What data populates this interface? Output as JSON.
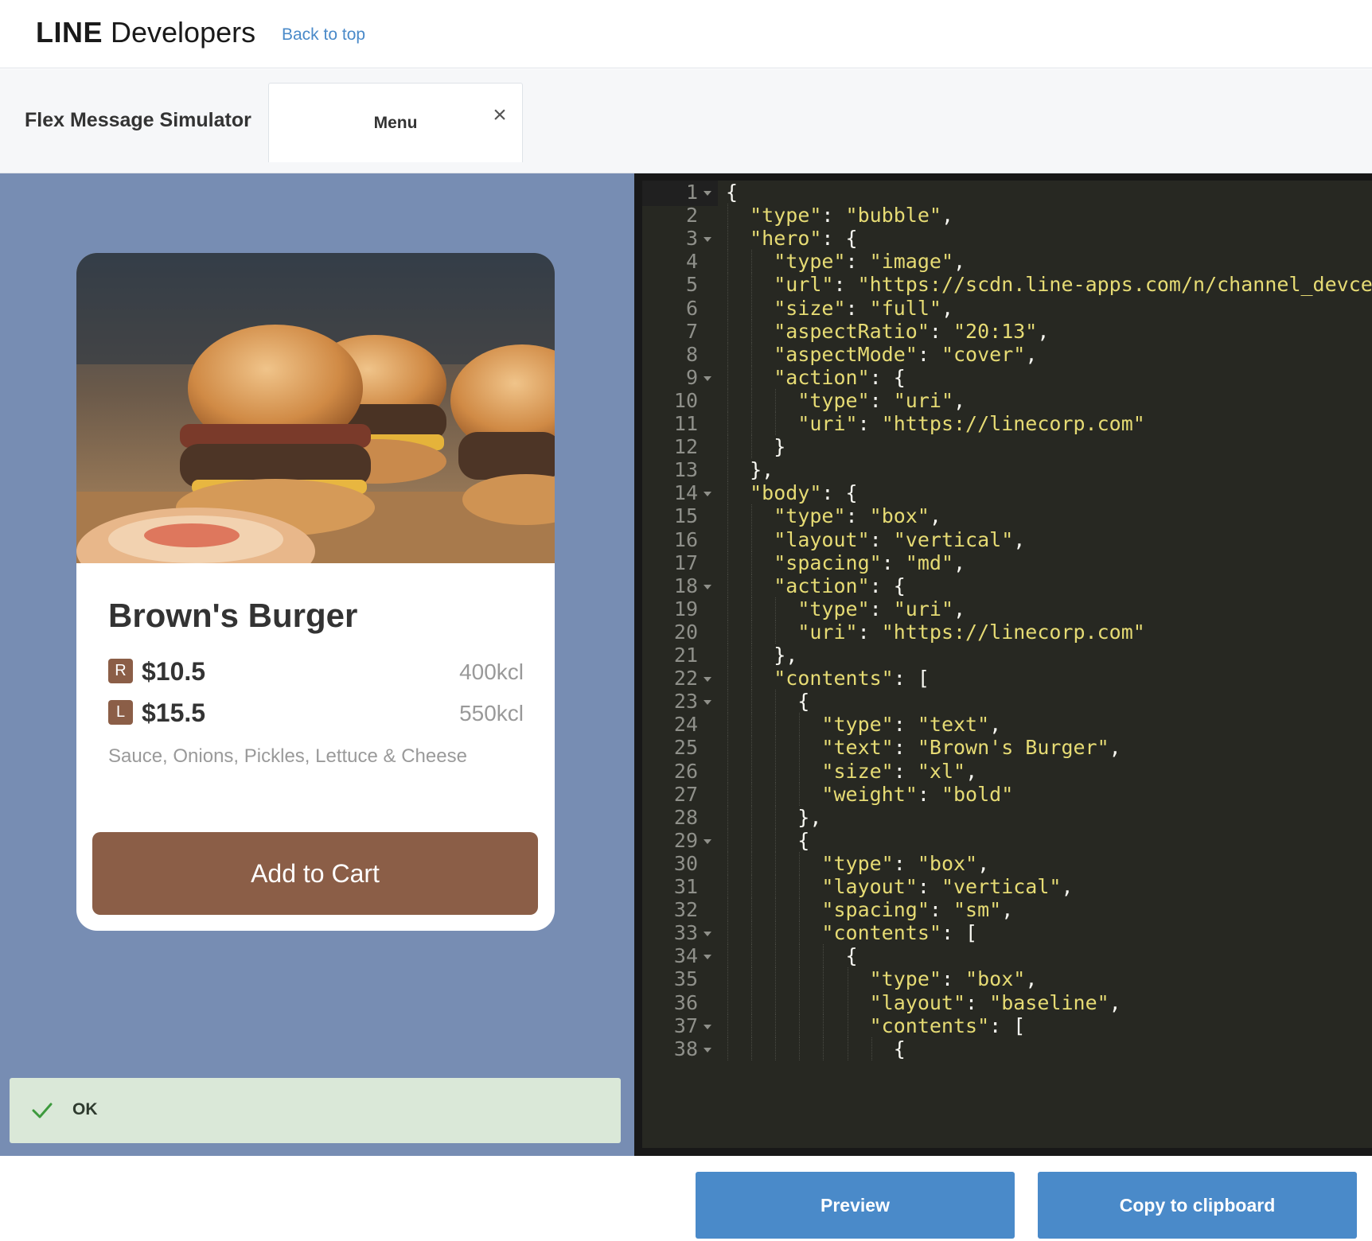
{
  "header": {
    "brand_bold": "LINE",
    "brand_rest": "Developers",
    "back_link": "Back to top"
  },
  "tabs": {
    "section_title": "Flex Message Simulator",
    "active_tab": "Menu"
  },
  "preview": {
    "background_color": "#778db3",
    "hero_image": "burger-photo",
    "item_name": "Brown's Burger",
    "prices": [
      {
        "size": "R",
        "price": "$10.5",
        "kcal": "400kcl"
      },
      {
        "size": "L",
        "price": "$15.5",
        "kcal": "550kcl"
      }
    ],
    "ingredients": "Sauce, Onions, Pickles, Lettuce & Cheese",
    "cart_button": "Add to Cart",
    "accent_color": "#8b5e47"
  },
  "status": {
    "icon": "check-icon",
    "text": "OK"
  },
  "editor": {
    "lines": [
      "{",
      "  \"type\": \"bubble\",",
      "  \"hero\": {",
      "    \"type\": \"image\",",
      "    \"url\": \"https://scdn.line-apps.com/n/channel_devcente",
      "    \"size\": \"full\",",
      "    \"aspectRatio\": \"20:13\",",
      "    \"aspectMode\": \"cover\",",
      "    \"action\": {",
      "      \"type\": \"uri\",",
      "      \"uri\": \"https://linecorp.com\"",
      "    }",
      "  },",
      "  \"body\": {",
      "    \"type\": \"box\",",
      "    \"layout\": \"vertical\",",
      "    \"spacing\": \"md\",",
      "    \"action\": {",
      "      \"type\": \"uri\",",
      "      \"uri\": \"https://linecorp.com\"",
      "    },",
      "    \"contents\": [",
      "      {",
      "        \"type\": \"text\",",
      "        \"text\": \"Brown's Burger\",",
      "        \"size\": \"xl\",",
      "        \"weight\": \"bold\"",
      "      },",
      "      {",
      "        \"type\": \"box\",",
      "        \"layout\": \"vertical\",",
      "        \"spacing\": \"sm\",",
      "        \"contents\": [",
      "          {",
      "            \"type\": \"box\",",
      "            \"layout\": \"baseline\",",
      "            \"contents\": [",
      "              {"
    ],
    "foldable_lines": [
      1,
      3,
      9,
      14,
      18,
      22,
      23,
      29,
      33,
      34,
      37,
      38
    ],
    "string_color": "#e6db74"
  },
  "footer": {
    "preview_button": "Preview",
    "copy_button": "Copy to clipboard",
    "button_color": "#4a8ac9"
  }
}
